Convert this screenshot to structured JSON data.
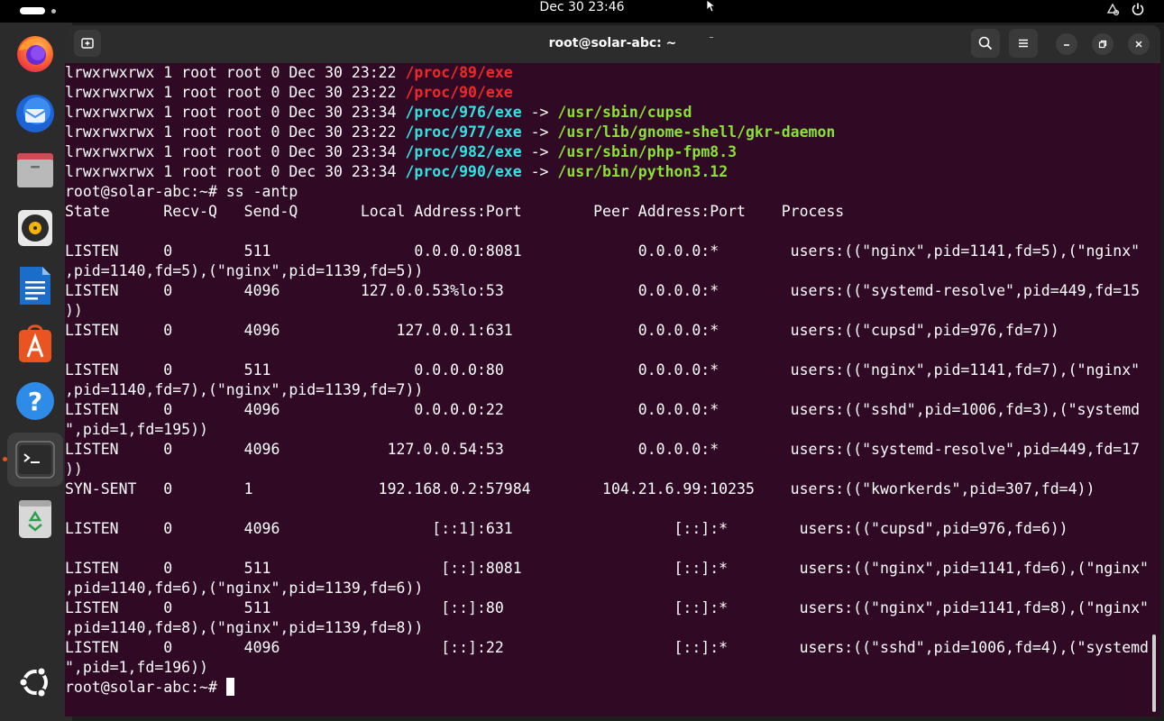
{
  "topbar": {
    "clock": "Dec 30  23:46",
    "icons": [
      "activities-icon",
      "network-icon",
      "power-icon"
    ]
  },
  "dock": {
    "items": [
      {
        "name": "Firefox",
        "icon": "firefox-icon"
      },
      {
        "name": "Thunderbird",
        "icon": "thunderbird-icon"
      },
      {
        "name": "Files",
        "icon": "files-icon"
      },
      {
        "name": "Rhythmbox",
        "icon": "rhythmbox-icon"
      },
      {
        "name": "LibreOffice Writer",
        "icon": "writer-icon"
      },
      {
        "name": "App Center",
        "icon": "app-center-icon"
      },
      {
        "name": "Help",
        "icon": "help-icon"
      },
      {
        "name": "Terminal",
        "icon": "terminal-icon",
        "active": true
      },
      {
        "name": "Trash",
        "icon": "trash-icon"
      },
      {
        "name": "Show Apps",
        "icon": "ubuntu-logo-icon"
      }
    ]
  },
  "window": {
    "title": "root@solar-abc: ~",
    "colors": {
      "background": "#300a24",
      "headerbar": "#2c2c2c",
      "broken_link": "#ef2929",
      "symlink": "#34e2e2",
      "executable": "#8ae234"
    }
  },
  "terminal": {
    "proc_lines": [
      {
        "perm": "lrwxrwxrwx 1 root root 0 Dec 30 23:22 ",
        "path": "/proc/89/exe",
        "broken": true,
        "arrow": "",
        "target": ""
      },
      {
        "perm": "lrwxrwxrwx 1 root root 0 Dec 30 23:22 ",
        "path": "/proc/90/exe",
        "broken": true,
        "arrow": "",
        "target": ""
      },
      {
        "perm": "lrwxrwxrwx 1 root root 0 Dec 30 23:34 ",
        "path": "/proc/976/exe",
        "broken": false,
        "arrow": " -> ",
        "target": "/usr/sbin/cupsd"
      },
      {
        "perm": "lrwxrwxrwx 1 root root 0 Dec 30 23:22 ",
        "path": "/proc/977/exe",
        "broken": false,
        "arrow": " -> ",
        "target": "/usr/lib/gnome-shell/gkr-daemon"
      },
      {
        "perm": "lrwxrwxrwx 1 root root 0 Dec 30 23:34 ",
        "path": "/proc/982/exe",
        "broken": false,
        "arrow": " -> ",
        "target": "/usr/sbin/php-fpm8.3"
      },
      {
        "perm": "lrwxrwxrwx 1 root root 0 Dec 30 23:34 ",
        "path": "/proc/990/exe",
        "broken": false,
        "arrow": " -> ",
        "target": "/usr/bin/python3.12"
      }
    ],
    "command_line": "root@solar-abc:~# ss -antp",
    "output_lines": [
      "State      Recv-Q   Send-Q       Local Address:Port        Peer Address:Port    Process",
      "",
      "LISTEN     0        511                0.0.0.0:8081             0.0.0.0:*        users:((\"nginx\",pid=1141,fd=5),(\"nginx\"",
      ",pid=1140,fd=5),(\"nginx\",pid=1139,fd=5))",
      "LISTEN     0        4096         127.0.0.53%lo:53               0.0.0.0:*        users:((\"systemd-resolve\",pid=449,fd=15",
      "))",
      "LISTEN     0        4096             127.0.0.1:631              0.0.0.0:*        users:((\"cupsd\",pid=976,fd=7))",
      "",
      "LISTEN     0        511                0.0.0.0:80               0.0.0.0:*        users:((\"nginx\",pid=1141,fd=7),(\"nginx\"",
      ",pid=1140,fd=7),(\"nginx\",pid=1139,fd=7))",
      "LISTEN     0        4096               0.0.0.0:22               0.0.0.0:*        users:((\"sshd\",pid=1006,fd=3),(\"systemd",
      "\",pid=1,fd=195))",
      "LISTEN     0        4096            127.0.0.54:53               0.0.0.0:*        users:((\"systemd-resolve\",pid=449,fd=17",
      "))",
      "SYN-SENT   0        1              192.168.0.2:57984        104.21.6.99:10235    users:((\"kworkerds\",pid=307,fd=4))",
      "",
      "LISTEN     0        4096                 [::1]:631                  [::]:*        users:((\"cupsd\",pid=976,fd=6))",
      "",
      "LISTEN     0        511                   [::]:8081                 [::]:*        users:((\"nginx\",pid=1141,fd=6),(\"nginx\"",
      ",pid=1140,fd=6),(\"nginx\",pid=1139,fd=6))",
      "LISTEN     0        511                   [::]:80                   [::]:*        users:((\"nginx\",pid=1141,fd=8),(\"nginx\"",
      ",pid=1140,fd=8),(\"nginx\",pid=1139,fd=8))",
      "LISTEN     0        4096                  [::]:22                   [::]:*        users:((\"sshd\",pid=1006,fd=4),(\"systemd",
      "\",pid=1,fd=196))"
    ],
    "prompt": "root@solar-abc:~# "
  }
}
